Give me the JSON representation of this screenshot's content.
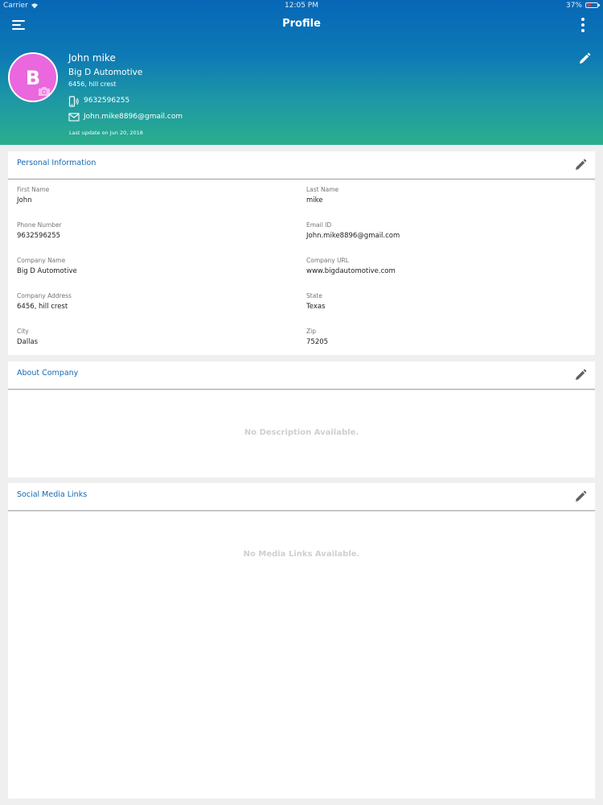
{
  "status_bar": {
    "carrier": "Carrier",
    "time": "12:05 PM",
    "battery": "37%"
  },
  "nav": {
    "title": "Profile"
  },
  "profile": {
    "avatar_letter": "B",
    "avatar_color": "#ea67dd",
    "name": "John mike",
    "company": "Big D Automotive",
    "address": "6456, hill crest",
    "phone": "9632596255",
    "email": "John.mike8896@gmail.com",
    "last_update": "Last update on Jun 20, 2018"
  },
  "personal_info": {
    "title": "Personal Information",
    "fields": [
      {
        "label": "First Name",
        "value": "John"
      },
      {
        "label": "Last Name",
        "value": "mike"
      },
      {
        "label": "Phone Number",
        "value": "9632596255"
      },
      {
        "label": "Email ID",
        "value": "John.mike8896@gmail.com"
      },
      {
        "label": "Company Name",
        "value": "Big D Automotive"
      },
      {
        "label": "Company URL",
        "value": "www.bigdautomotive.com"
      },
      {
        "label": "Company Address",
        "value": "6456, hill crest"
      },
      {
        "label": "State",
        "value": "Texas"
      },
      {
        "label": "City",
        "value": "Dallas"
      },
      {
        "label": "Zip",
        "value": "75205"
      }
    ]
  },
  "about_company": {
    "title": "About Company",
    "empty_text": "No Description Available."
  },
  "social_media": {
    "title": "Social Media Links",
    "empty_text": "No Media Links Available."
  },
  "colors": {
    "accent": "#1469b3",
    "header_top": "#0767b6",
    "header_bottom": "#2aae8c"
  },
  "icons": {
    "menu": "hamburger-menu-icon",
    "more": "more-vertical-icon",
    "edit": "pencil-icon",
    "camera": "camera-icon",
    "phone": "phone-icon",
    "email": "mail-icon"
  }
}
